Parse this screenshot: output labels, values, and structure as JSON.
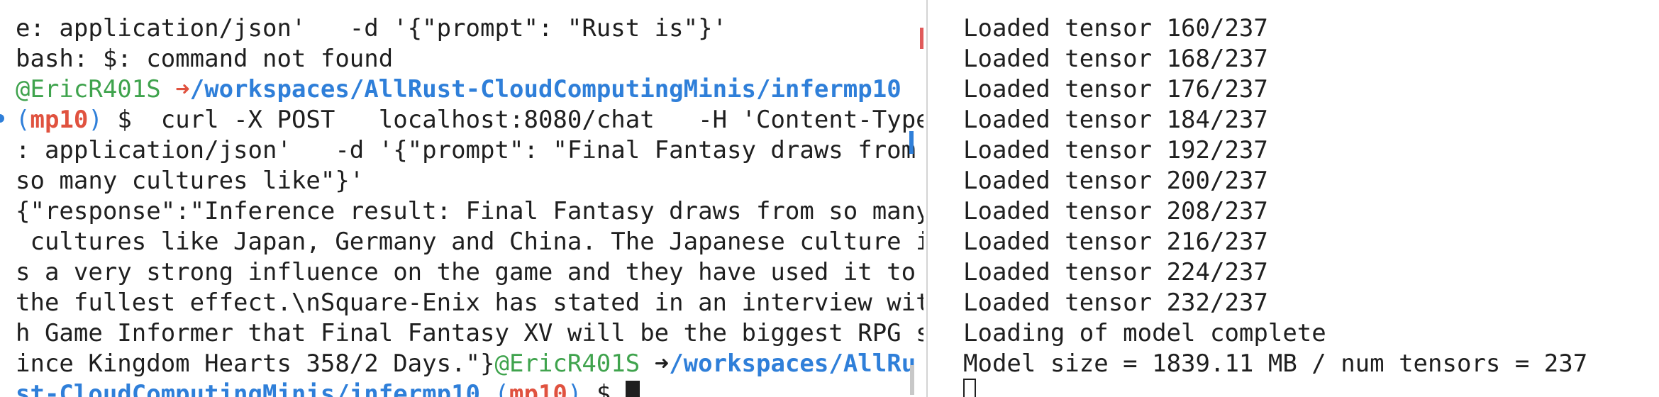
{
  "left": {
    "l1": "e: application/json'   -d '{\"prompt\": \"Rust is\"}'",
    "l2": "bash: $: command not found",
    "l3_user": "@EricR401S",
    "l3_arrow": "➜",
    "l3_path": "/workspaces/AllRust-CloudComputingMinis/infermp10",
    "l4_open": "(",
    "l4_env": "mp10",
    "l4_close": ")",
    "l4_cmd": " $  curl -X POST   localhost:8080/chat   -H 'Content-Type",
    "l5": ": application/json'   -d '{\"prompt\": \"Final Fantasy draws from",
    "l6": "so many cultures like\"}'",
    "l7": "{\"response\":\"Inference result: Final Fantasy draws from so many",
    "l8": " cultures like Japan, Germany and China. The Japanese culture i",
    "l9": "s a very strong influence on the game and they have used it to",
    "l10": "the fullest effect.\\nSquare-Enix has stated in an interview wit",
    "l11": "h Game Informer that Final Fantasy XV will be the biggest RPG s",
    "l12_text": "ince Kingdom Hearts 358/2 Days.\"}",
    "l12_user": "@EricR401S",
    "l12_arrow": "➜",
    "l12_path": "/workspaces/AllRu",
    "l13_path": "st-CloudComputingMinis/infermp10",
    "l13_open": "(",
    "l13_env": "mp10",
    "l13_close": ")",
    "l13_prompt": " $ "
  },
  "right": {
    "lines": [
      "Loaded tensor 160/237",
      "Loaded tensor 168/237",
      "Loaded tensor 176/237",
      "Loaded tensor 184/237",
      "Loaded tensor 192/237",
      "Loaded tensor 200/237",
      "Loaded tensor 208/237",
      "Loaded tensor 216/237",
      "Loaded tensor 224/237",
      "Loaded tensor 232/237",
      "Loading of model complete",
      "Model size = 1839.11 MB / num tensors = 237"
    ]
  },
  "colors": {
    "user": "#3fa34d",
    "path": "#2f7fd9",
    "env": "#e0523f",
    "text": "#1f1f1f",
    "background": "#ffffff"
  }
}
